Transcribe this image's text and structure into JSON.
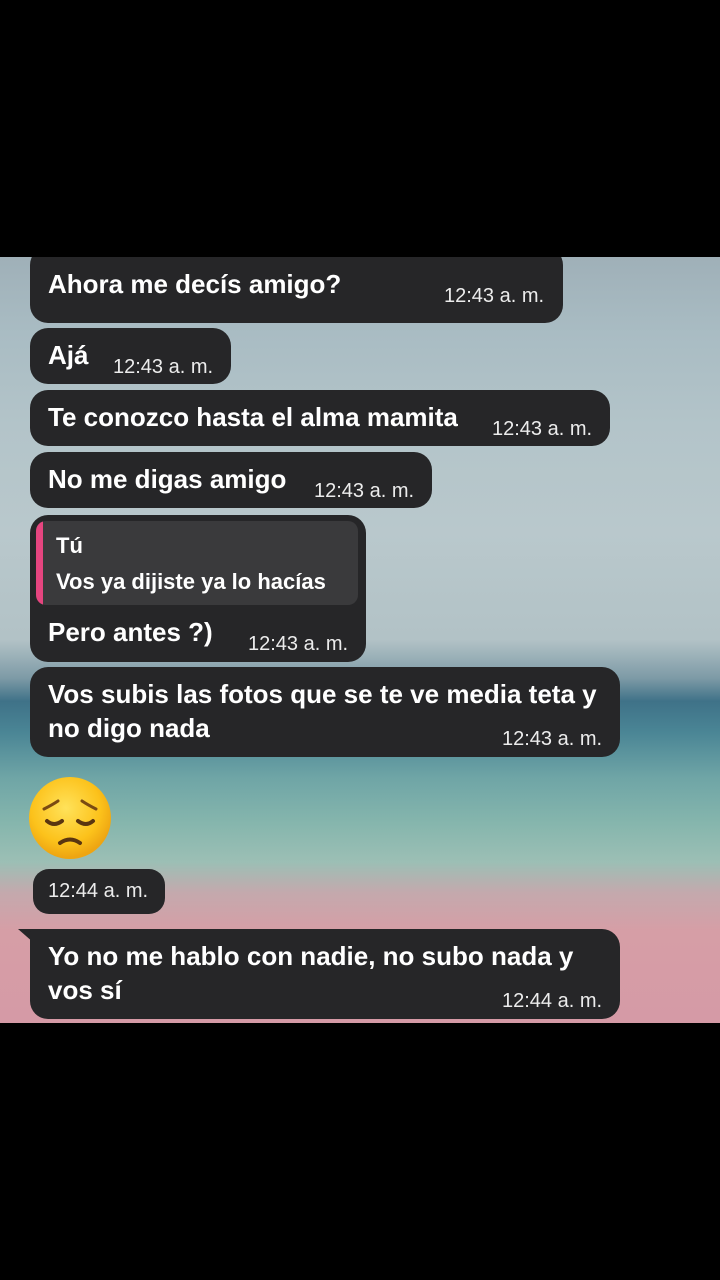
{
  "messages": [
    {
      "text": "Ahora me decís amigo?",
      "time": "12:43 a. m."
    },
    {
      "text": "Ajá",
      "time": "12:43 a. m."
    },
    {
      "text": "Te conozco hasta el alma mamita",
      "time": "12:43 a. m."
    },
    {
      "text": "No me digas amigo",
      "time": "12:43 a. m."
    },
    {
      "quote": {
        "author": "Tú",
        "text": "Vos ya dijiste ya lo hacías"
      },
      "text": "Pero antes ?)",
      "time": "12:43 a. m."
    },
    {
      "lines": [
        "Vos subis las fotos que se te ve media teta y",
        "no digo nada"
      ],
      "time": "12:43 a. m."
    },
    {
      "emoji": "pensive-face-icon",
      "time": "12:44 a. m."
    },
    {
      "lines": [
        "Yo no me hablo con nadie, no subo nada y",
        "vos sí"
      ],
      "time": "12:44 a. m."
    }
  ]
}
